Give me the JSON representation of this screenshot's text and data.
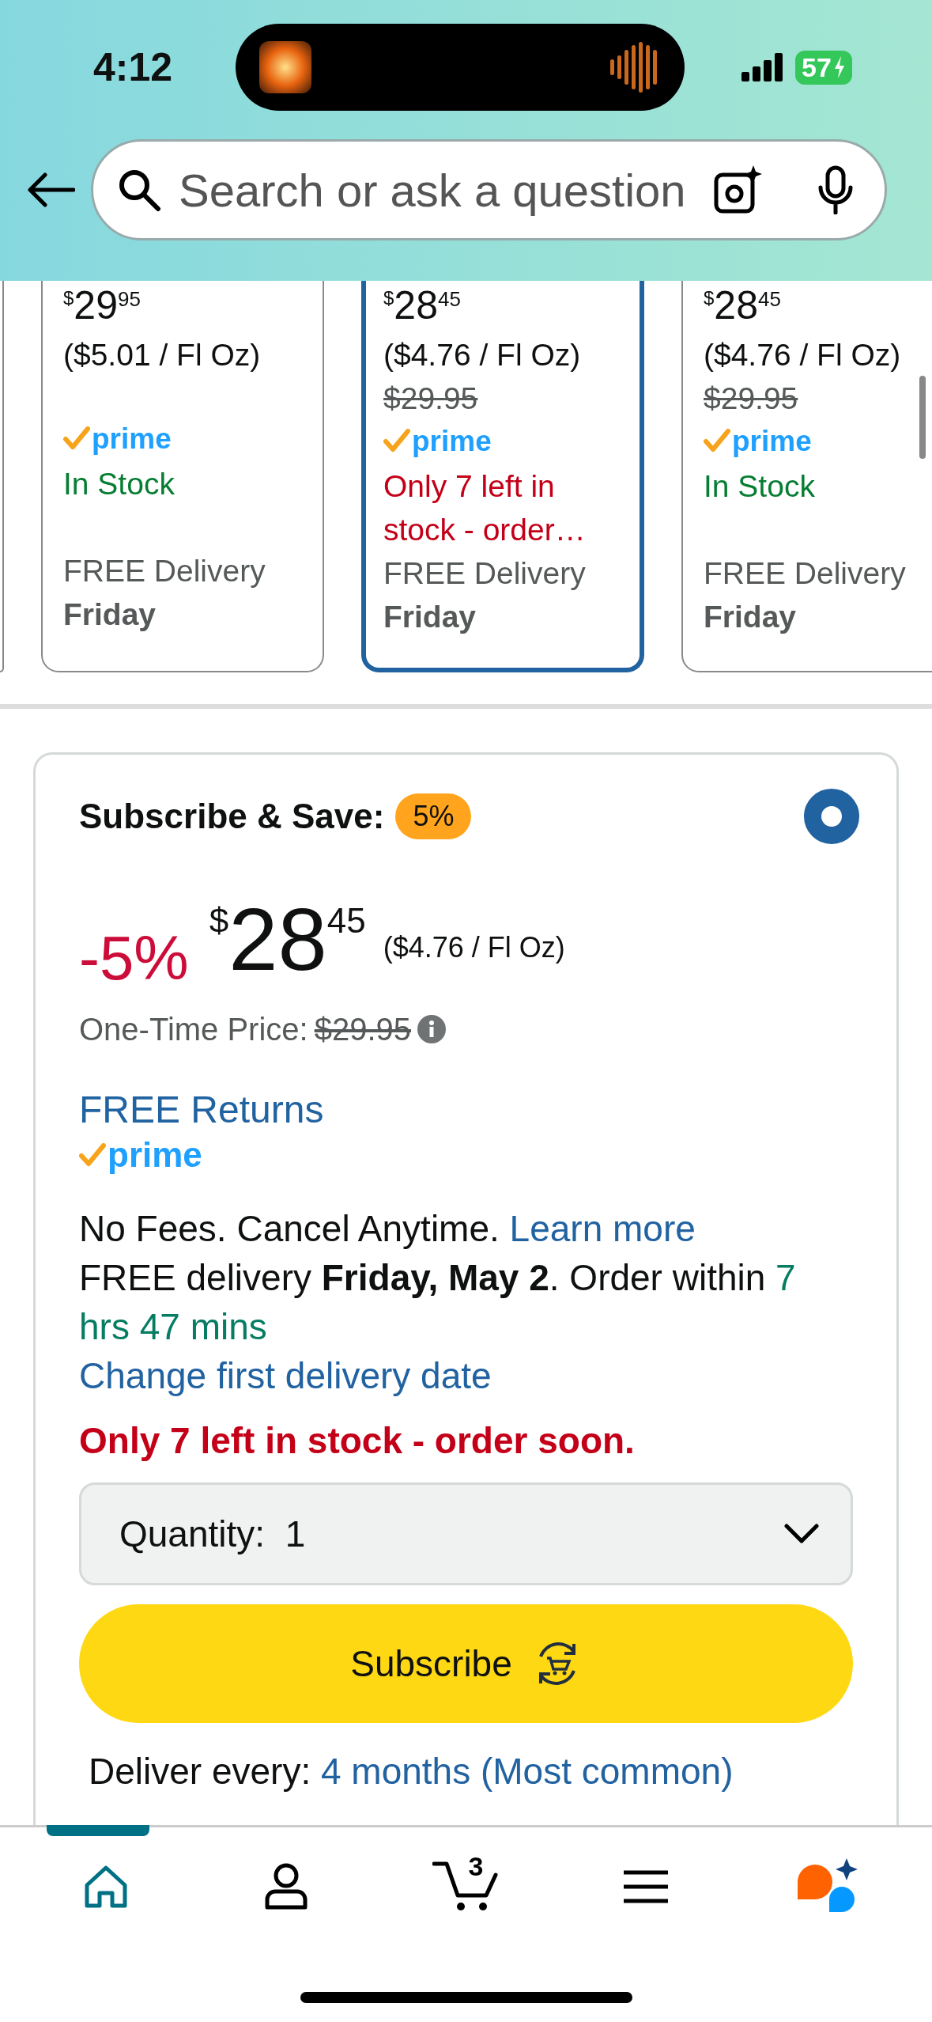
{
  "status_bar": {
    "time": "4:12",
    "battery": "57"
  },
  "search": {
    "placeholder": "Search or ask a question"
  },
  "offers": [
    {
      "currency": "$",
      "whole": "29",
      "cents": "95",
      "unit_price": "($5.01 / Fl Oz)",
      "prime": "prime",
      "stock": "In Stock",
      "kind": "in_stock",
      "delivery": "FREE Delivery",
      "day": "Friday",
      "selected": false
    },
    {
      "currency": "$",
      "whole": "28",
      "cents": "45",
      "unit_price": "($4.76 / Fl Oz)",
      "list_price": "$29.95",
      "prime": "prime",
      "stock": "Only 7 left in stock - order…",
      "kind": "low",
      "delivery": "FREE Delivery",
      "day": "Friday",
      "selected": true
    },
    {
      "currency": "$",
      "whole": "28",
      "cents": "45",
      "unit_price": "($4.76 / Fl Oz)",
      "list_price": "$29.95",
      "prime": "prime",
      "stock": "In Stock",
      "kind": "in_stock",
      "delivery": "FREE Delivery",
      "day": "Friday",
      "selected": false
    }
  ],
  "subscribe": {
    "title": "Subscribe & Save:",
    "badge": "5%",
    "selected": true,
    "discount": "-5%",
    "currency": "$",
    "whole": "28",
    "cents": "45",
    "unit_price": "($4.76 / Fl Oz)",
    "one_time_label": "One-Time Price:",
    "one_time_price": "$29.95",
    "returns": "FREE Returns",
    "prime": "prime",
    "fees": "No Fees. Cancel Anytime.",
    "learn_more": "Learn more",
    "delivery": "FREE delivery **Friday, May 2**. Order within",
    "countdown": "7 hrs 47 mins",
    "change_date": "Change first delivery date",
    "stock": "Only 7 left in stock - order soon.",
    "quantity": {
      "label": "Quantity:",
      "value": "1"
    },
    "button": "Subscribe",
    "deliver_every": {
      "label": "Deliver every:",
      "value": "4 months (Most common)"
    }
  },
  "bottom_nav": [
    {
      "kind": "home",
      "selected": true
    },
    {
      "kind": "account",
      "selected": false
    },
    {
      "kind": "cart",
      "badge": "3",
      "selected": false
    },
    {
      "kind": "menu",
      "selected": false
    },
    {
      "kind": "assistant",
      "selected": false
    }
  ]
}
